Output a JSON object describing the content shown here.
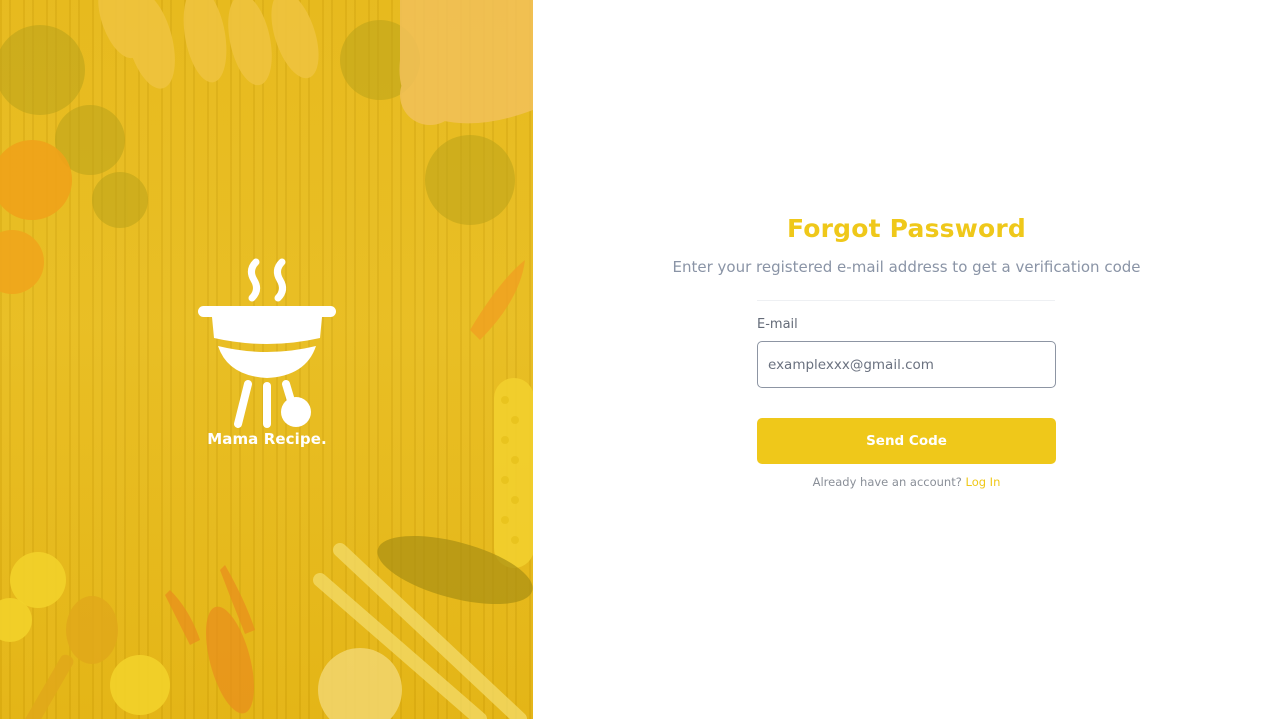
{
  "hero": {
    "brand_name": "Mama Recipe.",
    "logo_icon": "grill-icon",
    "background_color": "#e6b81b"
  },
  "form": {
    "title": "Forgot Password",
    "subtitle": "Enter your registered e-mail address to get a verification code",
    "email_label": "E-mail",
    "email_placeholder": "examplexxx@gmail.com",
    "email_value": "",
    "submit_label": "Send Code",
    "login_prompt": "Already have an account?",
    "login_link": "Log In"
  },
  "colors": {
    "accent": "#efc81a",
    "muted_text": "#8a94a6"
  }
}
